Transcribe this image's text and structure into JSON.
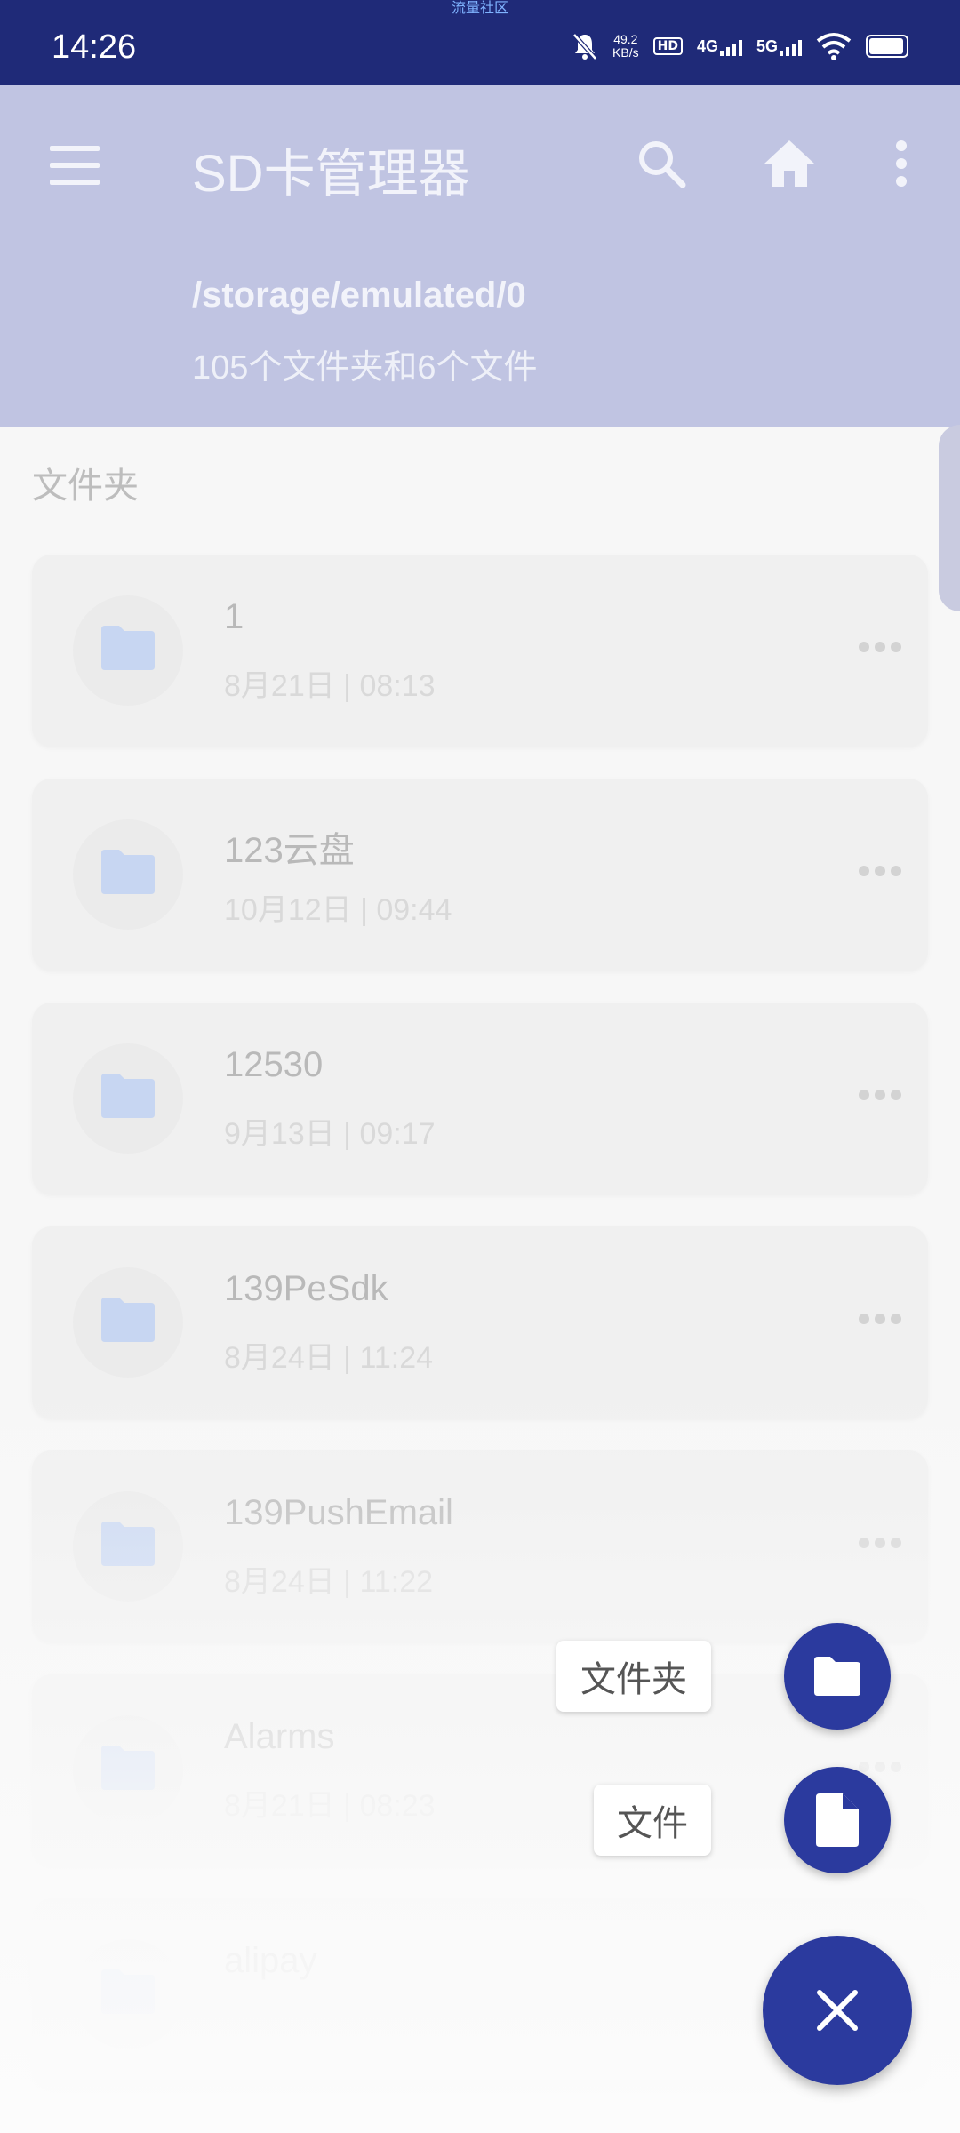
{
  "status_bar": {
    "carrier_text": "流量社区",
    "time": "14:26",
    "net_speed_value": "49.2",
    "net_speed_unit": "KB/s",
    "sim1": "4G",
    "sim2": "5G"
  },
  "app_bar": {
    "title": "SD卡管理器",
    "path": "/storage/emulated/0",
    "summary": "105个文件夹和6个文件"
  },
  "section_label": "文件夹",
  "folders": [
    {
      "name": "1",
      "date": "8月21日 | 08:13"
    },
    {
      "name": "123云盘",
      "date": "10月12日 | 09:44"
    },
    {
      "name": "12530",
      "date": "9月13日 | 09:17"
    },
    {
      "name": "139PeSdk",
      "date": "8月24日 | 11:24"
    },
    {
      "name": "139PushEmail",
      "date": "8月24日 | 11:22"
    },
    {
      "name": "Alarms",
      "date": "8月21日 | 08:23"
    },
    {
      "name": "alipay",
      "date": ""
    }
  ],
  "fab": {
    "folder_label": "文件夹",
    "file_label": "文件"
  },
  "colors": {
    "status_bar": "#1f2a78",
    "app_bar": "#c0c4e2",
    "fab": "#2b3a9e",
    "folder_icon": "#c7d6f2"
  }
}
